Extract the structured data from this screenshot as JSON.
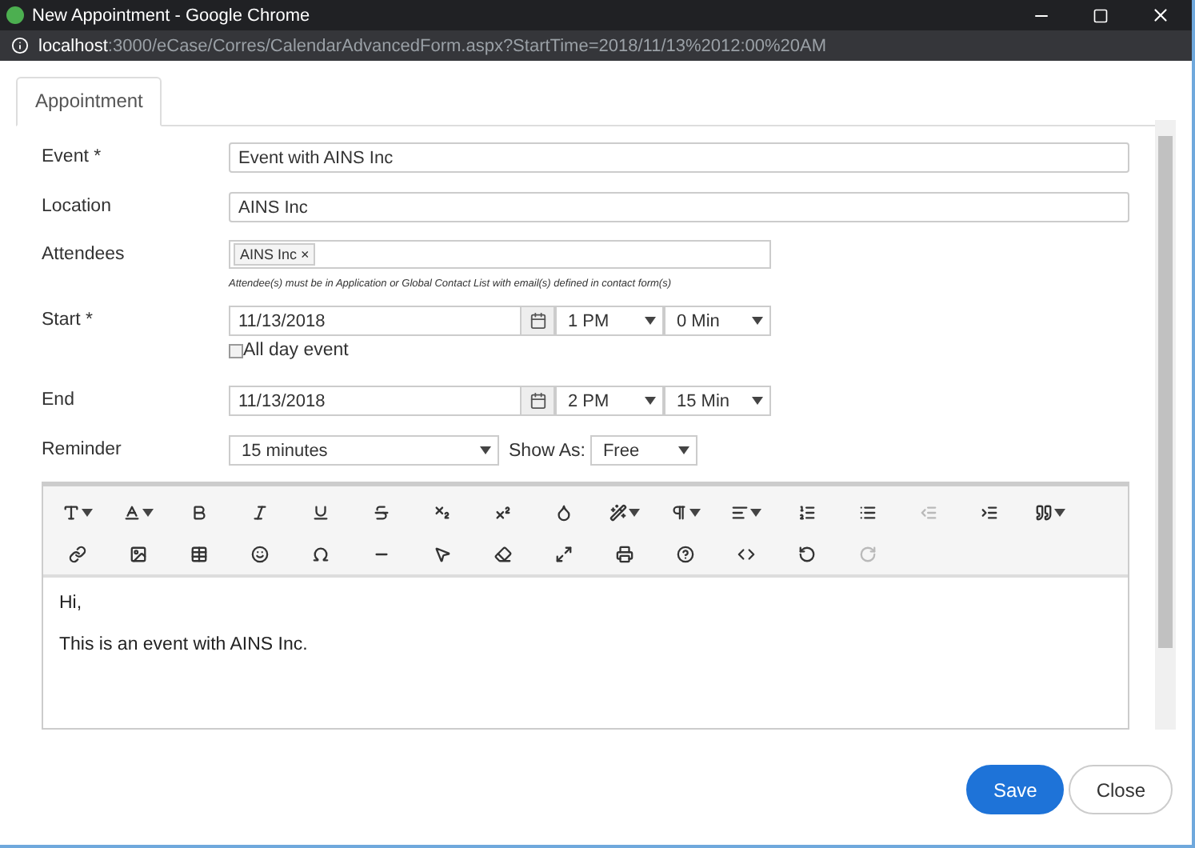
{
  "window": {
    "title": "New Appointment - Google Chrome",
    "url_host": "localhost",
    "url_rest": ":3000/eCase/Corres/CalendarAdvancedForm.aspx?StartTime=2018/11/13%2012:00%20AM"
  },
  "tabs": [
    {
      "label": "Appointment",
      "selected": true
    }
  ],
  "form": {
    "event": {
      "label": "Event *",
      "value": "Event with AINS Inc"
    },
    "location": {
      "label": "Location",
      "value": "AINS Inc"
    },
    "attendees": {
      "label": "Attendees",
      "tags": [
        {
          "label": "AINS Inc",
          "remove": "×"
        }
      ],
      "hint": "Attendee(s) must be in Application or Global Contact List with email(s) defined in contact form(s)"
    },
    "start": {
      "label": "Start *",
      "date": "11/13/2018",
      "hour": "1 PM",
      "minute": "0 Min"
    },
    "all_day": {
      "label": "All day event",
      "checked": false
    },
    "end": {
      "label": "End",
      "date": "11/13/2018",
      "hour": "2 PM",
      "minute": "15 Min"
    },
    "reminder": {
      "label": "Reminder",
      "value": "15 minutes"
    },
    "show_as": {
      "label": "Show As:",
      "value": "Free"
    }
  },
  "toolbar": [
    [
      {
        "kind": "font",
        "dropdown": true,
        "disabled": false
      },
      {
        "kind": "size",
        "dropdown": true,
        "disabled": false
      },
      {
        "kind": "bold",
        "dropdown": false,
        "disabled": false
      },
      {
        "kind": "italic",
        "dropdown": false,
        "disabled": false
      },
      {
        "kind": "underline",
        "dropdown": false,
        "disabled": false
      },
      {
        "kind": "strike",
        "dropdown": false,
        "disabled": false
      },
      {
        "kind": "sub",
        "dropdown": false,
        "disabled": false
      },
      {
        "kind": "sup",
        "dropdown": false,
        "disabled": false
      }
    ],
    [
      {
        "kind": "color",
        "dropdown": false,
        "disabled": false
      },
      {
        "kind": "magic",
        "dropdown": true,
        "disabled": false
      }
    ],
    [
      {
        "kind": "paragraph",
        "dropdown": true,
        "disabled": false
      },
      {
        "kind": "align",
        "dropdown": true,
        "disabled": false
      },
      {
        "kind": "ordered",
        "dropdown": false,
        "disabled": false
      },
      {
        "kind": "bullets",
        "dropdown": false,
        "disabled": false
      },
      {
        "kind": "outdent",
        "dropdown": false,
        "disabled": true
      },
      {
        "kind": "indent",
        "dropdown": false,
        "disabled": false
      },
      {
        "kind": "quote",
        "dropdown": true,
        "disabled": false
      }
    ],
    [
      {
        "kind": "link",
        "dropdown": false,
        "disabled": false
      },
      {
        "kind": "image",
        "dropdown": false,
        "disabled": false
      },
      {
        "kind": "table",
        "dropdown": false,
        "disabled": false
      }
    ],
    [
      {
        "kind": "emoji",
        "dropdown": false,
        "disabled": false
      },
      {
        "kind": "omega",
        "dropdown": false,
        "disabled": false
      },
      {
        "kind": "rule",
        "dropdown": false,
        "disabled": false
      },
      {
        "kind": "pointer",
        "dropdown": false,
        "disabled": false
      },
      {
        "kind": "eraser",
        "dropdown": false,
        "disabled": false
      }
    ],
    [
      {
        "kind": "fullscreen",
        "dropdown": false,
        "disabled": false
      },
      {
        "kind": "print",
        "dropdown": false,
        "disabled": false
      },
      {
        "kind": "help",
        "dropdown": false,
        "disabled": false
      },
      {
        "kind": "code",
        "dropdown": false,
        "disabled": false
      }
    ],
    [
      {
        "kind": "undo",
        "dropdown": false,
        "disabled": false
      },
      {
        "kind": "redo",
        "dropdown": false,
        "disabled": true
      }
    ]
  ],
  "editor": {
    "paragraphs": [
      "Hi,",
      "This is an event with AINS Inc."
    ]
  },
  "buttons": [
    {
      "label": "Save",
      "kind": "primary"
    },
    {
      "label": "Close",
      "kind": "secondary"
    }
  ]
}
